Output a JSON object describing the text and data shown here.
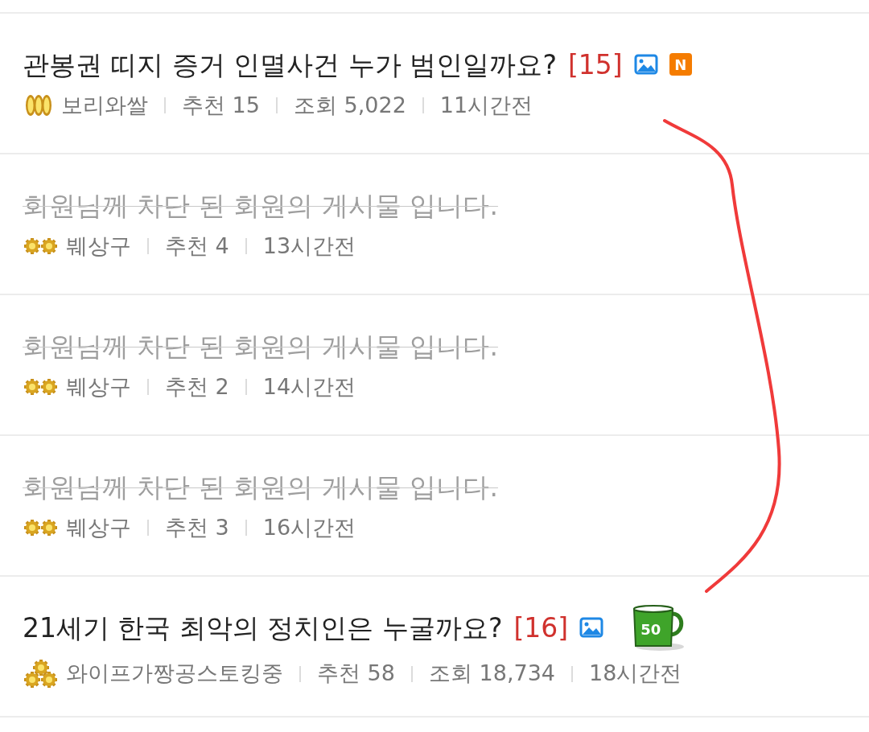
{
  "posts": [
    {
      "kind": "normal",
      "title": "관봉권 띠지 증거 인멸사건 누가 범인일까요?",
      "comment_count": "[15]",
      "has_image": true,
      "new_badge": "N",
      "author_badge": {
        "kind": "coins"
      },
      "author": "보리와쌀",
      "meta": [
        "추천 15",
        "조회 5,022",
        "11시간전"
      ]
    },
    {
      "kind": "blocked",
      "title": "회원님께 차단 된 회원의 게시물 입니다.",
      "author_badge": {
        "kind": "gears2"
      },
      "author": "붸상구",
      "meta": [
        "추천 4",
        "13시간전"
      ]
    },
    {
      "kind": "blocked",
      "title": "회원님께 차단 된 회원의 게시물 입니다.",
      "author_badge": {
        "kind": "gears2"
      },
      "author": "붸상구",
      "meta": [
        "추천 2",
        "14시간전"
      ]
    },
    {
      "kind": "blocked",
      "title": "회원님께 차단 된 회원의 게시물 입니다.",
      "author_badge": {
        "kind": "gears2"
      },
      "author": "붸상구",
      "meta": [
        "추천 3",
        "16시간전"
      ]
    },
    {
      "kind": "normal",
      "title": "21세기 한국 최악의 정치인은 누굴까요?",
      "comment_count": "[16]",
      "has_image": true,
      "mug_badge": "50",
      "author_badge": {
        "kind": "gears3"
      },
      "author": "와이프가짱공스토킹중",
      "meta": [
        "추천 58",
        "조회 18,734",
        "18시간전"
      ]
    }
  ]
}
